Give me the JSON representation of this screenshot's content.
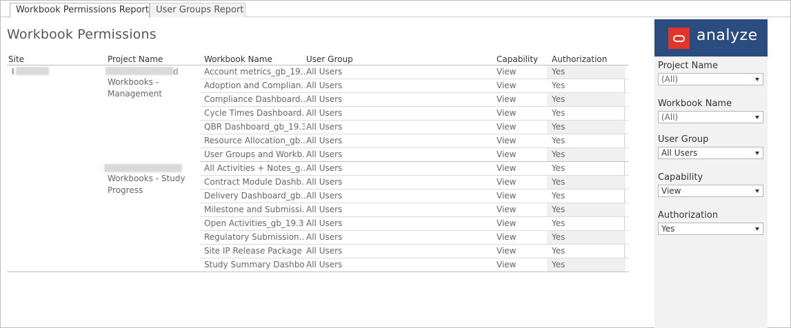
{
  "tabs": [
    {
      "label": "Workbook Permissions Report",
      "active": true
    },
    {
      "label": "User Groups Report",
      "active": false
    }
  ],
  "title": "Workbook Permissions",
  "table": {
    "headers": {
      "site": "Site",
      "project": "Project Name",
      "workbook": "Workbook Name",
      "user_group": "User Group",
      "capability": "Capability",
      "authorization": "Authorization"
    },
    "site_value": "I",
    "groups": [
      {
        "project_suffix": "d",
        "project_label": "Workbooks - Management",
        "rows": [
          {
            "workbook": "Account metrics_gb_19..",
            "user_group": "All Users",
            "capability": "View",
            "authorization": "Yes"
          },
          {
            "workbook": "Adoption and Complian..",
            "user_group": "All Users",
            "capability": "View",
            "authorization": "Yes"
          },
          {
            "workbook": "Compliance Dashboard..",
            "user_group": "All Users",
            "capability": "View",
            "authorization": "Yes"
          },
          {
            "workbook": "Cycle Times Dashboard..",
            "user_group": "All Users",
            "capability": "View",
            "authorization": "Yes"
          },
          {
            "workbook": "QBR Dashboard_gb_19.3",
            "user_group": "All Users",
            "capability": "View",
            "authorization": "Yes"
          },
          {
            "workbook": "Resource Allocation_gb..",
            "user_group": "All Users",
            "capability": "View",
            "authorization": "Yes"
          },
          {
            "workbook": "User Groups and Workb..",
            "user_group": "All Users",
            "capability": "View",
            "authorization": "Yes"
          }
        ]
      },
      {
        "project_suffix": "",
        "project_label": "Workbooks - Study Progress",
        "rows": [
          {
            "workbook": "All Activities + Notes_g..",
            "user_group": "All Users",
            "capability": "View",
            "authorization": "Yes"
          },
          {
            "workbook": "Contract Module Dashb..",
            "user_group": "All Users",
            "capability": "View",
            "authorization": "Yes"
          },
          {
            "workbook": "Delivery Dashboard_gb..",
            "user_group": "All Users",
            "capability": "View",
            "authorization": "Yes"
          },
          {
            "workbook": "Milestone and Submissi..",
            "user_group": "All Users",
            "capability": "View",
            "authorization": "Yes"
          },
          {
            "workbook": "Open Activities_gb_19.3",
            "user_group": "All Users",
            "capability": "View",
            "authorization": "Yes"
          },
          {
            "workbook": "Regulatory Submission..",
            "user_group": "All Users",
            "capability": "View",
            "authorization": "Yes"
          },
          {
            "workbook": "Site IP Release Package ..",
            "user_group": "All Users",
            "capability": "View",
            "authorization": "Yes"
          },
          {
            "workbook": "Study Summary Dashbo..",
            "user_group": "All Users",
            "capability": "View",
            "authorization": "Yes"
          }
        ]
      }
    ]
  },
  "panel": {
    "logo_text": "analyze",
    "brand_color": "#2b4c7e",
    "logo_color": "#e2352a",
    "filters": [
      {
        "label": "Project Name",
        "value": "(All)"
      },
      {
        "label": "Workbook Name",
        "value": "(All)"
      },
      {
        "label": "User Group",
        "value": "All Users"
      },
      {
        "label": "Capability",
        "value": "View"
      },
      {
        "label": "Authorization",
        "value": "Yes"
      }
    ]
  }
}
